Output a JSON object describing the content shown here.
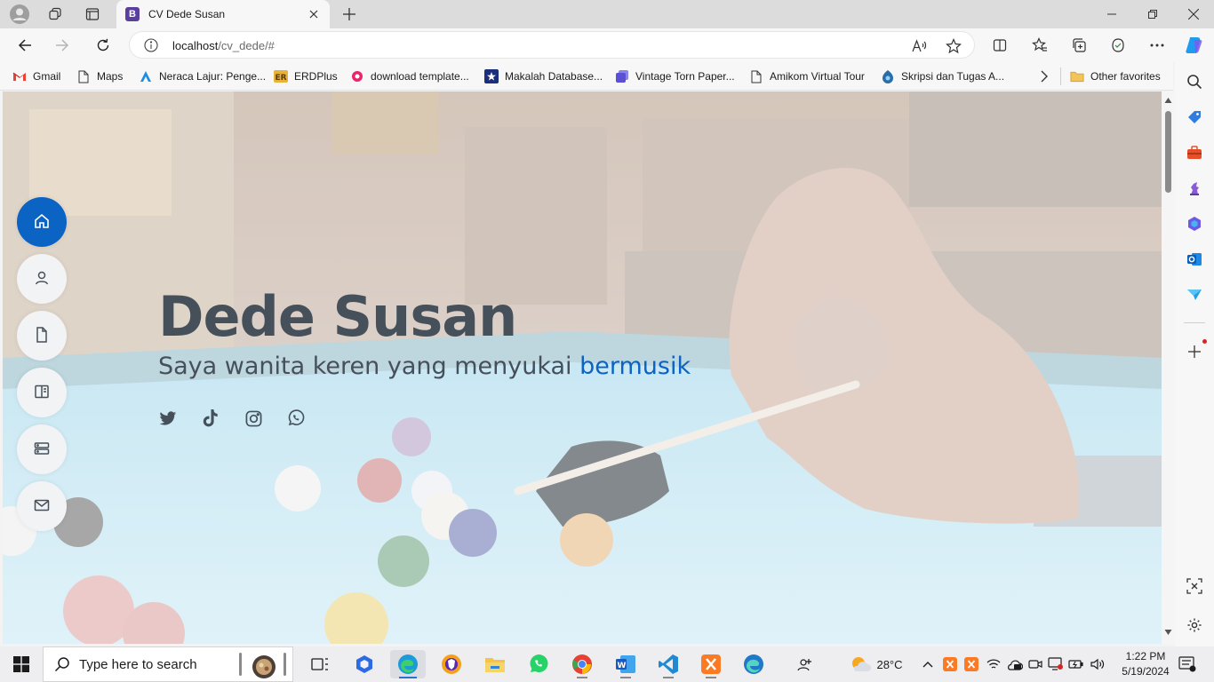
{
  "browser": {
    "tab_title": "CV Dede Susan",
    "tab_favicon": "B",
    "url_host": "localhost",
    "url_path": "/cv_dede/#"
  },
  "bookmarks": [
    {
      "label": "Gmail",
      "icon": "gmail-icon"
    },
    {
      "label": "Maps",
      "icon": "page-icon"
    },
    {
      "label": "Neraca Lajur: Penge...",
      "icon": "lajur-icon"
    },
    {
      "label": "ERDPlus",
      "icon": "erdplus-icon"
    },
    {
      "label": "download template...",
      "icon": "template-icon"
    },
    {
      "label": "Makalah Database...",
      "icon": "makalah-icon"
    },
    {
      "label": "Vintage Torn Paper...",
      "icon": "vintage-icon"
    },
    {
      "label": "Amikom Virtual Tour",
      "icon": "page-icon"
    },
    {
      "label": "Skripsi dan Tugas A...",
      "icon": "skripsi-icon"
    }
  ],
  "bookmarks_other": "Other favorites",
  "hero": {
    "name": "Dede Susan",
    "subtitle_prefix": "Saya wanita keren yang menyukai ",
    "subtitle_accent": "bermusik"
  },
  "side_nav": [
    "home-icon",
    "person-icon",
    "file-icon",
    "book-icon",
    "server-icon",
    "mail-icon"
  ],
  "social": [
    "twitter-icon",
    "tiktok-icon",
    "instagram-icon",
    "whatsapp-icon"
  ],
  "taskbar": {
    "search_placeholder": "Type here to search",
    "weather": "28°C",
    "time": "1:22 PM",
    "date": "5/19/2024"
  },
  "colors": {
    "accent": "#0b63c4",
    "text": "#45505b"
  }
}
